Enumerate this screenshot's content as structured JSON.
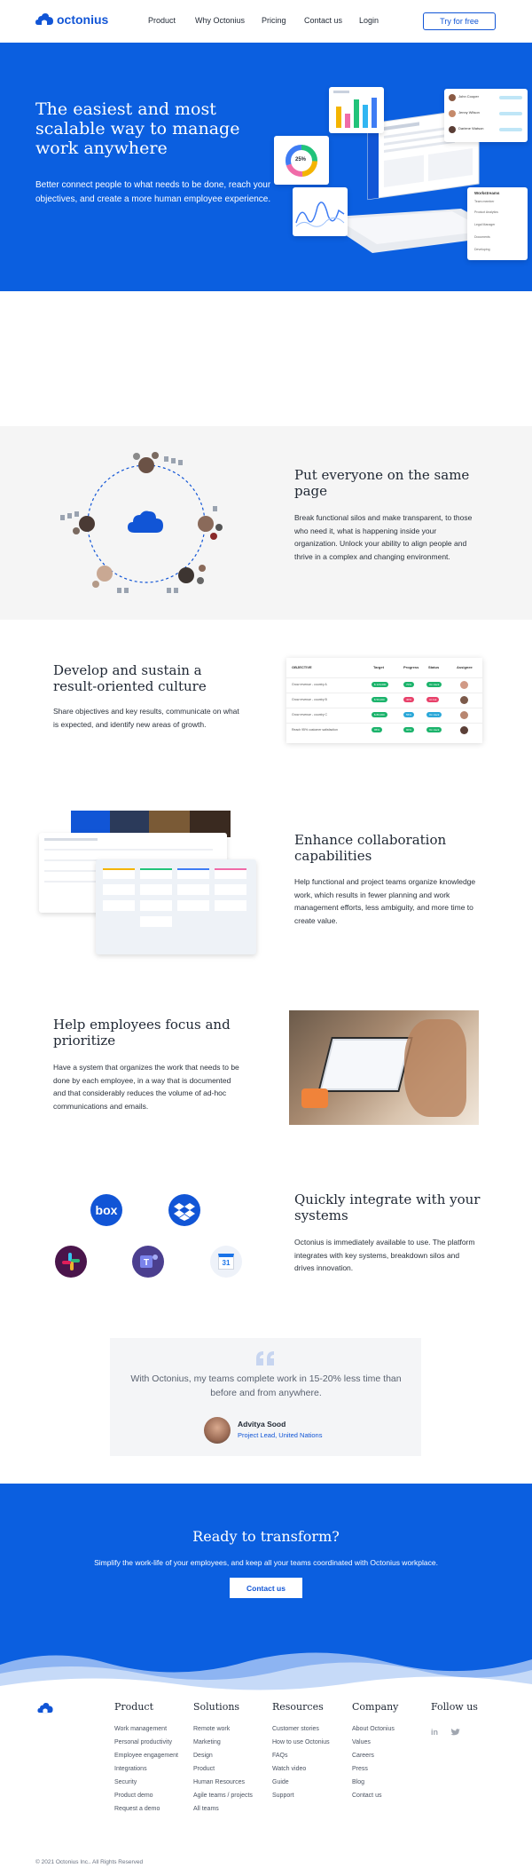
{
  "nav": {
    "brand": "octonius",
    "links": [
      "Product",
      "Why Octonius",
      "Pricing",
      "Contact us",
      "Login"
    ],
    "cta": "Try for free"
  },
  "hero": {
    "title": "The easiest and most scalable way to manage work anywhere",
    "subtitle": "Better connect people to what needs to be done, reach your objectives, and create a more human employee experience.",
    "mock": {
      "donut_value": "25%",
      "people": [
        {
          "name": "John Cooper"
        },
        {
          "name": "Jenny Wilson"
        },
        {
          "name": "Darlene Watson"
        }
      ],
      "notes_title": "Workstreams",
      "notes": [
        "Team member",
        "Product Analytics",
        "Legal Manager",
        "Documents",
        "Developing"
      ]
    }
  },
  "features": [
    {
      "title": "Put everyone on the same page",
      "body": "Break functional silos and make transparent, to those who need it, what is happening inside your organization. Unlock your ability to align people and thrive in a complex and changing environment."
    },
    {
      "title": "Develop and sustain a result-oriented culture",
      "body": "Share objectives and key results, communicate on what is expected, and identify new areas of growth."
    },
    {
      "title": "Enhance collaboration capabilities",
      "body": "Help functional and project teams organize knowledge work, which results in fewer planning and work management efforts, less ambiguity, and more time to create value."
    },
    {
      "title": "Help employees focus and prioritize",
      "body": "Have a system that organizes the work that needs to be done by each employee, in a way that is documented and that considerably reduces the volume of ad-hoc communications and emails."
    },
    {
      "title": "Quickly integrate with your systems",
      "body": "Octonius is immediately available to use. The platform integrates with key systems, breakdown silos and drives innovation."
    }
  ],
  "okr_table": {
    "headers": [
      "OBJECTIVE",
      "Target",
      "Progress",
      "Status",
      "Assignee"
    ],
    "rows": [
      {
        "objective": "Grow revenue - country A",
        "target": "$ 120,000",
        "progress": "70%",
        "status": "On track"
      },
      {
        "objective": "Grow revenue - country B",
        "target": "$ 50,000",
        "progress": "40%",
        "status": "At risk"
      },
      {
        "objective": "Grow revenue - country C",
        "target": "$ 80,000",
        "progress": "55%",
        "status": "On track"
      },
      {
        "objective": "Reach 95% customer satisfaction",
        "target": "95%",
        "progress": "90%",
        "status": "On track"
      }
    ]
  },
  "integrations": [
    "box",
    "Dropbox",
    "Slack",
    "Microsoft Teams",
    "Google Calendar"
  ],
  "calendar_day": "31",
  "testimonial": {
    "quote": "With Octonius, my teams complete work in 15-20% less time than before and from anywhere.",
    "name": "Advitya Sood",
    "role": "Project Lead, United Nations"
  },
  "cta": {
    "title": "Ready to transform?",
    "subtitle": "Simplify the work-life of your employees, and keep all your teams coordinated with Octonius workplace.",
    "button": "Contact us"
  },
  "footer": {
    "columns": [
      {
        "title": "Product",
        "items": [
          "Work management",
          "Personal productivity",
          "Employee engagement",
          "Integrations",
          "Security",
          "Product demo",
          "Request a demo"
        ]
      },
      {
        "title": "Solutions",
        "items": [
          "Remote work",
          "Marketing",
          "Design",
          "Product",
          "Human Resources",
          "Agile teams / projects",
          "All teams"
        ]
      },
      {
        "title": "Resources",
        "items": [
          "Customer stories",
          "How to use Octonius",
          "FAQs",
          "Watch video",
          "Guide",
          "Support"
        ]
      },
      {
        "title": "Company",
        "items": [
          "About Octonius",
          "Values",
          "Careers",
          "Press",
          "Blog",
          "Contact us"
        ]
      },
      {
        "title": "Follow us",
        "items": []
      }
    ],
    "social": [
      "in",
      "twitter"
    ],
    "copyright": "© 2021 Octonius Inc.. All Rights Reserved"
  },
  "colors": {
    "brand": "#0b5fe0",
    "brand_dark": "#1155d6",
    "gray_section": "#f5f5f5",
    "status_green": "#1bb36b",
    "status_orange": "#f0902b"
  }
}
